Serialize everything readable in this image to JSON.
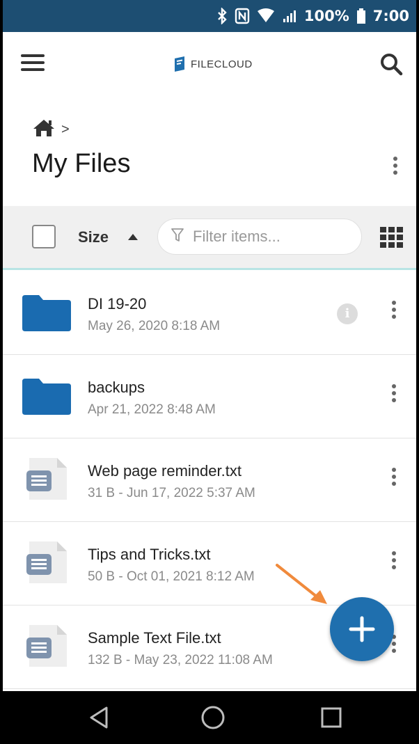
{
  "status_bar": {
    "battery": "100%",
    "time": "7:00",
    "icons": [
      "bluetooth-icon",
      "nfc-icon",
      "wifi-icon",
      "signal-icon",
      "battery-icon"
    ]
  },
  "app_bar": {
    "logo_text": "FILECLOUD",
    "icons": [
      "menu-icon",
      "search-icon"
    ]
  },
  "breadcrumb": {
    "separator": ">",
    "home_icon": "home-icon"
  },
  "page": {
    "title": "My Files"
  },
  "toolbar": {
    "sort_label": "Size",
    "sort_direction": "ascending",
    "filter_placeholder": "Filter items..."
  },
  "files": [
    {
      "name": "DI 19-20",
      "meta": "May 26, 2020 8:18 AM",
      "type": "folder",
      "icon": "folder-icon",
      "info": true
    },
    {
      "name": "backups",
      "meta": "Apr 21, 2022 8:48 AM",
      "type": "folder",
      "icon": "folder-icon",
      "info": false
    },
    {
      "name": "Web page reminder.txt",
      "meta": "31 B - Jun 17, 2022 5:37 AM",
      "type": "file",
      "icon": "text-file-icon",
      "info": false
    },
    {
      "name": "Tips and Tricks.txt",
      "meta": "50 B - Oct 01, 2021 8:12 AM",
      "type": "file",
      "icon": "text-file-icon",
      "info": false
    },
    {
      "name": "Sample Text File.txt",
      "meta": "132 B - May 23, 2022 11:08 AM",
      "type": "file",
      "icon": "text-file-icon",
      "info": false
    }
  ],
  "fab": {
    "icon": "plus-icon"
  },
  "nav": {
    "icons": [
      "back-icon",
      "home-circle-icon",
      "recents-icon"
    ]
  },
  "colors": {
    "status_bar": "#1d4e72",
    "accent": "#1f6fae",
    "folder": "#1a6bb0",
    "annotation": "#f08a3c"
  }
}
